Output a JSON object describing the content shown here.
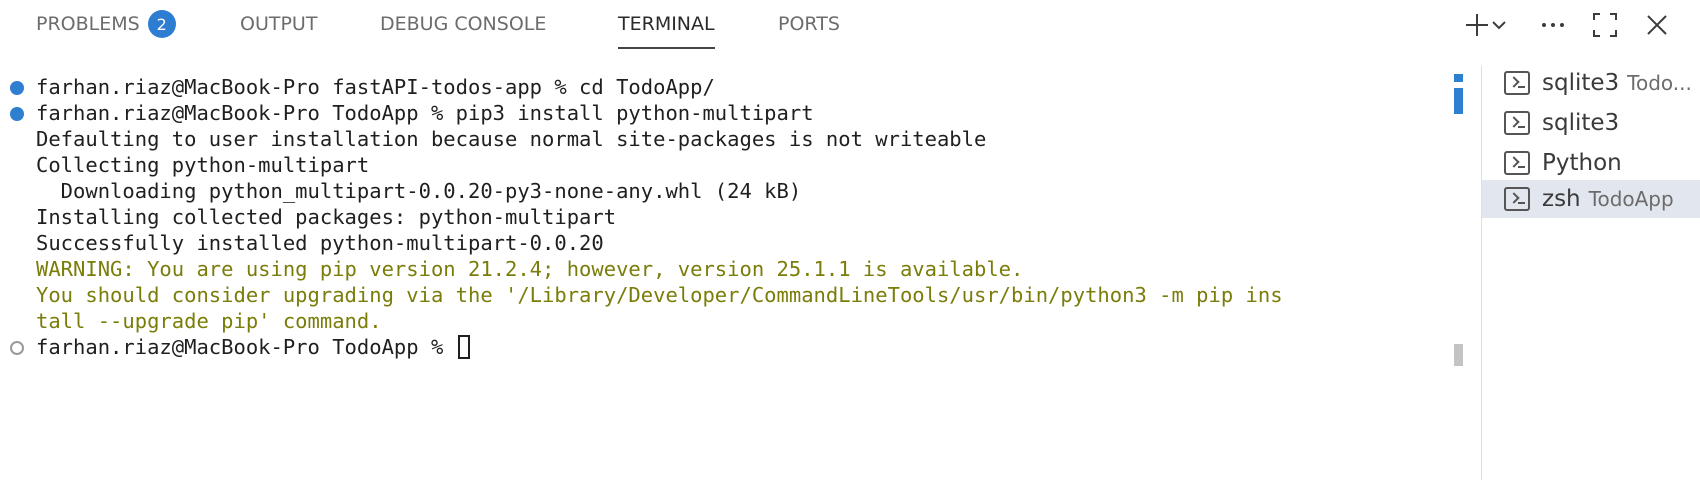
{
  "tabs": [
    {
      "label": "PROBLEMS",
      "badge": "2",
      "active": false
    },
    {
      "label": "OUTPUT",
      "active": false
    },
    {
      "label": "DEBUG CONSOLE",
      "active": false
    },
    {
      "label": "TERMINAL",
      "active": true
    },
    {
      "label": "PORTS",
      "active": false
    }
  ],
  "actions": [
    "plus-icon",
    "chevron-down-icon",
    "more-icon",
    "maximize-icon",
    "close-icon"
  ],
  "terminal": {
    "lines": [
      {
        "text": "farhan.riaz@MacBook-Pro fastAPI-todos-app % cd TodoApp/",
        "marker": "blue",
        "style": "normal"
      },
      {
        "text": "farhan.riaz@MacBook-Pro TodoApp % pip3 install python-multipart",
        "marker": "blue",
        "style": "normal"
      },
      {
        "text": "Defaulting to user installation because normal site-packages is not writeable",
        "marker": "",
        "style": "normal"
      },
      {
        "text": "Collecting python-multipart",
        "marker": "",
        "style": "normal"
      },
      {
        "text": "  Downloading python_multipart-0.0.20-py3-none-any.whl (24 kB)",
        "marker": "",
        "style": "normal"
      },
      {
        "text": "Installing collected packages: python-multipart",
        "marker": "",
        "style": "normal"
      },
      {
        "text": "Successfully installed python-multipart-0.0.20",
        "marker": "",
        "style": "normal"
      },
      {
        "text": "WARNING: You are using pip version 21.2.4; however, version 25.1.1 is available.",
        "marker": "",
        "style": "warn"
      },
      {
        "text": "You should consider upgrading via the '/Library/Developer/CommandLineTools/usr/bin/python3 -m pip ins",
        "marker": "",
        "style": "warn"
      },
      {
        "text": "tall --upgrade pip' command.",
        "marker": "",
        "style": "warn"
      },
      {
        "text": "farhan.riaz@MacBook-Pro TodoApp % ",
        "marker": "hollow",
        "style": "normal",
        "cursor": true
      }
    ]
  },
  "terminal_list": [
    {
      "name": "sqlite3",
      "desc": "Todo...",
      "selected": false
    },
    {
      "name": "sqlite3",
      "desc": "",
      "selected": false
    },
    {
      "name": "Python",
      "desc": "",
      "selected": false
    },
    {
      "name": "zsh",
      "desc": "TodoApp",
      "selected": true
    }
  ]
}
